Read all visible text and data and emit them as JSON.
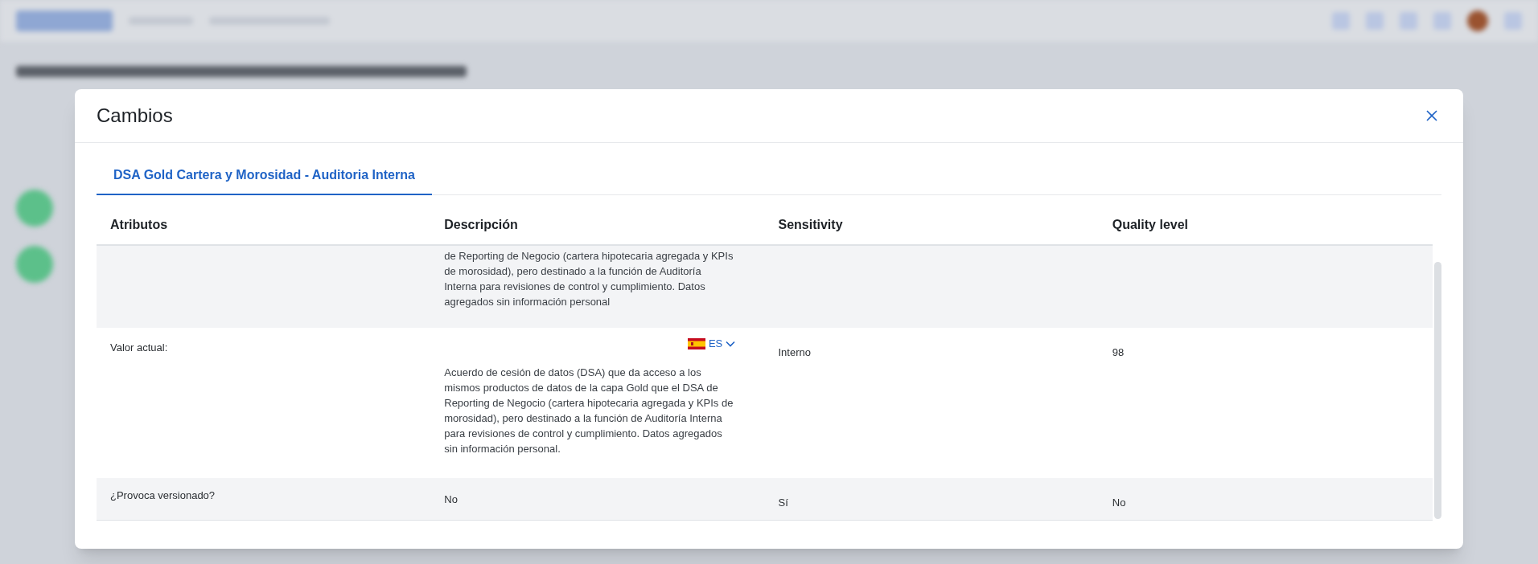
{
  "dialog": {
    "title": "Cambios"
  },
  "tabs": [
    {
      "label": "DSA Gold Cartera y Morosidad - Auditoria Interna",
      "selected": true
    }
  ],
  "table": {
    "columns": [
      "Atributos",
      "Descripción",
      "Sensitivity",
      "Quality level"
    ],
    "rows": [
      {
        "kind": "text",
        "description": "de Reporting de Negocio (cartera hipotecaria agregada y KPIs de morosidad), pero destinado a la función de Auditoría Interna para revisiones de control y cumplimiento. Datos agregados sin información personal"
      },
      {
        "kind": "translated",
        "attribute": "Valor actual:",
        "language": "ES",
        "description": "Acuerdo de cesión de datos (DSA) que da acceso a los mismos productos de datos de la capa Gold que el DSA de Reporting de Negocio (cartera hipotecaria agregada y KPIs de morosidad), pero destinado a la función de Auditoría Interna para revisiones de control y cumplimiento. Datos agregados sin información personal.",
        "sensitivity": "Interno",
        "quality_level": "98"
      },
      {
        "kind": "plain",
        "attribute": "¿Provoca versionado?",
        "description": "No",
        "sensitivity": "Sí",
        "quality_level": "No"
      }
    ]
  }
}
